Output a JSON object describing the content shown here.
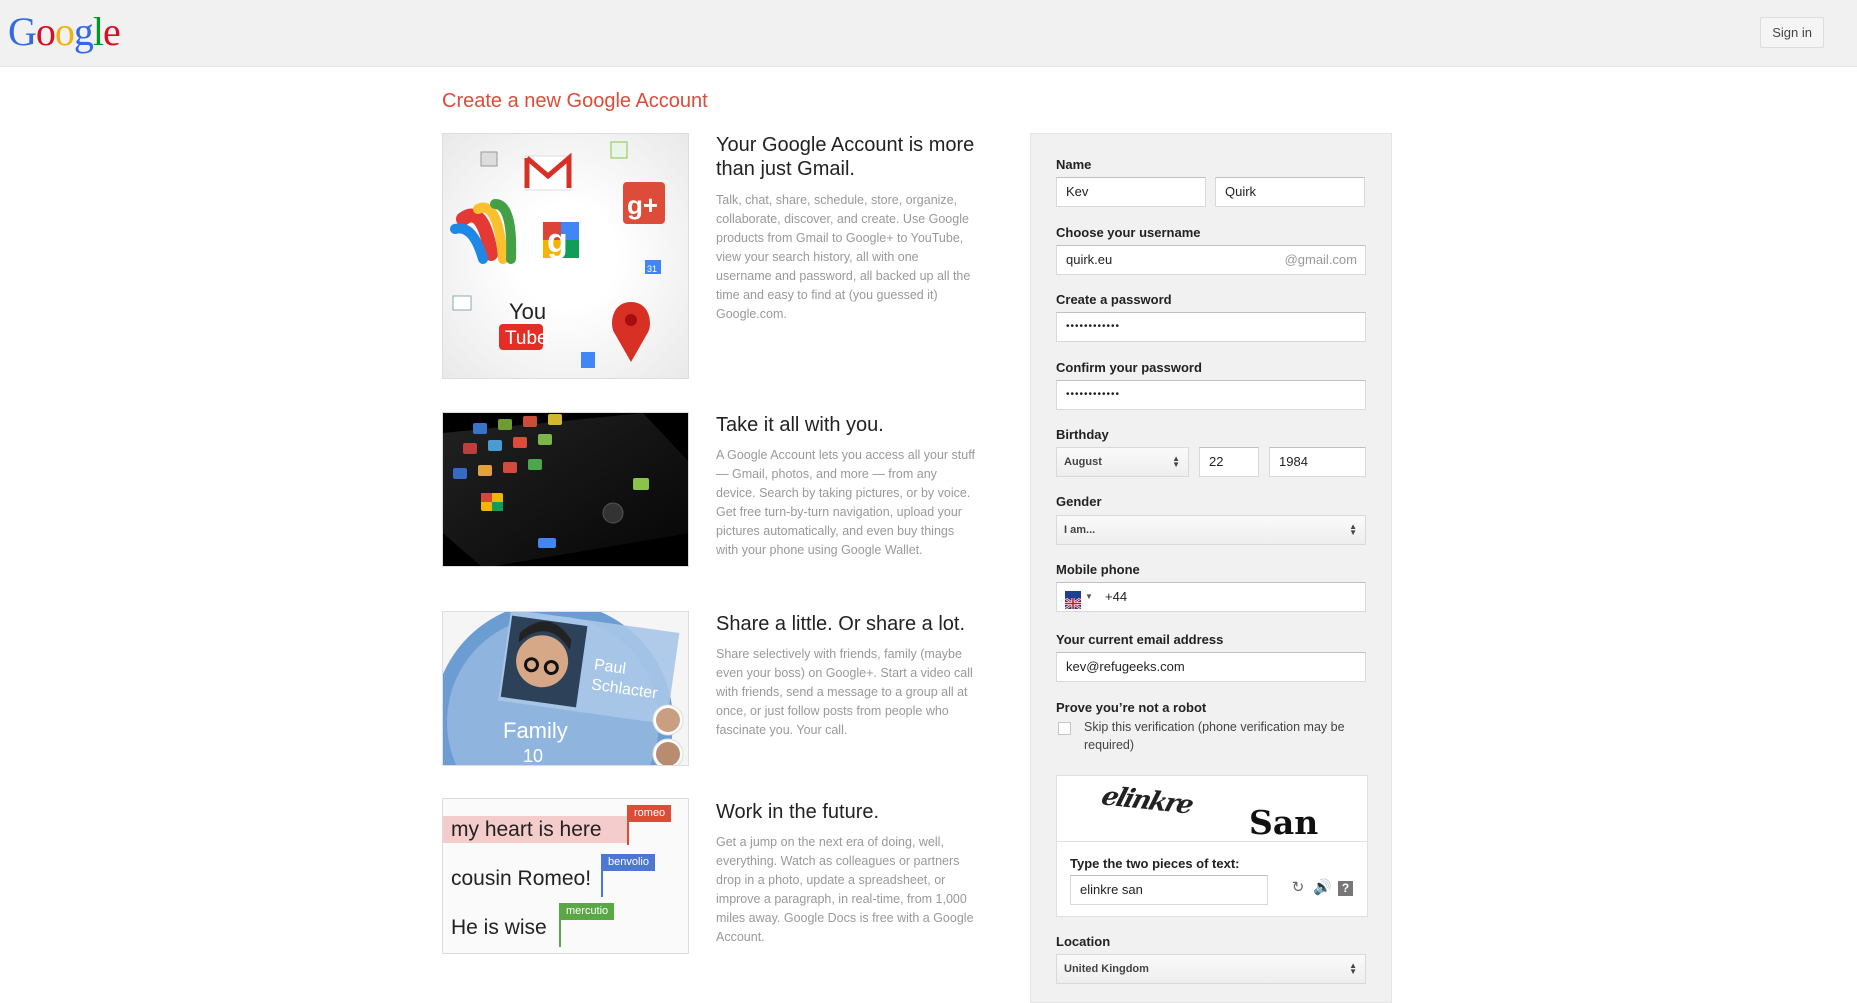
{
  "header": {
    "logo_letters": [
      "G",
      "o",
      "o",
      "g",
      "l",
      "e"
    ],
    "signin_label": "Sign in"
  },
  "page_title": "Create a new Google Account",
  "features": [
    {
      "heading": "Your Google Account is more than just Gmail.",
      "body": "Talk, chat, share, schedule, store, organize, collaborate, discover, and create. Use Google products from Gmail to Google+ to YouTube, view your search history, all with one username and password, all backed up all the time and easy to find at (you guessed it) Google.com."
    },
    {
      "heading": "Take it all with you.",
      "body": "A Google Account lets you access all your stuff — Gmail, photos, and more — from any device. Search by taking pictures, or by voice. Get free turn-by-turn navigation, upload your pictures automatically, and even buy things with your phone using Google Wallet."
    },
    {
      "heading": "Share a little. Or share a lot.",
      "body": "Share selectively with friends, family (maybe even your boss) on Google+. Start a video call with friends, send a message to a group all at once, or just follow posts from people who fascinate you. Your call."
    },
    {
      "heading": "Work in the future.",
      "body": "Get a jump on the next era of doing, well, everything. Watch as colleagues or partners drop in a photo, update a spreadsheet, or improve a paragraph, in real-time, from 1,000 miles away. Google Docs is free with a Google Account."
    }
  ],
  "images": {
    "youtube_top": "You",
    "youtube_bottom": "Tube",
    "calendar_day": "31",
    "circle_name": "Paul Schlacter",
    "circle_label": "Family",
    "circle_count": "10",
    "doc_lines": [
      "my heart is here",
      "cousin Romeo!",
      "He is wise"
    ],
    "doc_tags": [
      "romeo",
      "benvolio",
      "mercutio"
    ],
    "doc_tag_colors": [
      "#dd4b39",
      "#4d78d1",
      "#5aa745"
    ]
  },
  "form": {
    "name_label": "Name",
    "first_name": "Kev",
    "last_name": "Quirk",
    "username_label": "Choose your username",
    "username": "quirk.eu",
    "username_suffix": "@gmail.com",
    "password_label": "Create a password",
    "password": "••••••••••••",
    "confirm_label": "Confirm your password",
    "confirm": "••••••••••••",
    "birthday_label": "Birthday",
    "birth_month": "August",
    "birth_day": "22",
    "birth_year": "1984",
    "gender_label": "Gender",
    "gender": "I am...",
    "mobile_label": "Mobile phone",
    "mobile_prefix": "+44",
    "email_label": "Your current email address",
    "email": "kev@refugeeks.com",
    "robot_label": "Prove you’re not a robot",
    "skip_label": "Skip this verification (phone verification may be required)",
    "captcha_words": [
      "elinkre",
      "San"
    ],
    "captcha_prompt": "Type the two pieces of text:",
    "captcha_value": "elinkre san",
    "location_label": "Location",
    "location": "United Kingdom"
  }
}
